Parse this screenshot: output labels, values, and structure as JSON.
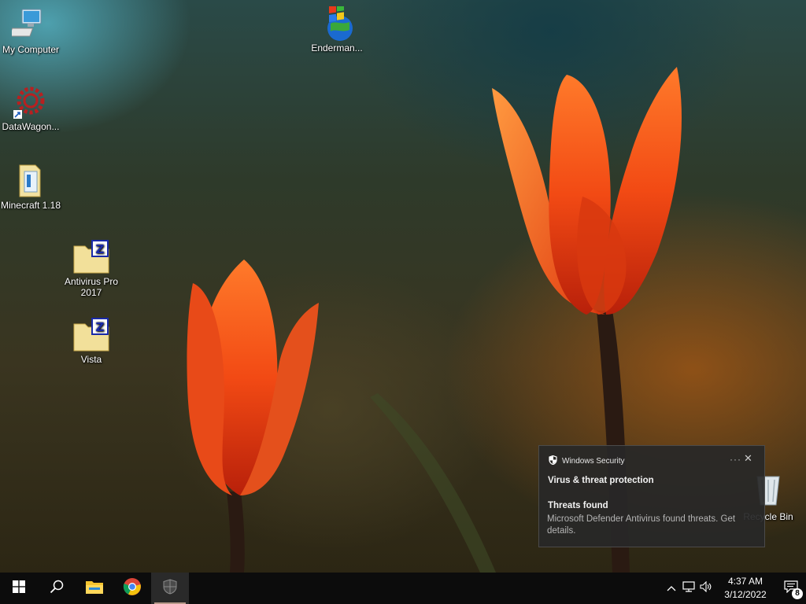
{
  "desktop": {
    "icons": [
      {
        "label": "My Computer"
      },
      {
        "label": "DataWagon..."
      },
      {
        "label": "Minecraft 1.18"
      },
      {
        "label": "Antivirus Pro 2017"
      },
      {
        "label": "Vista"
      },
      {
        "label": "Enderman..."
      }
    ],
    "recycle_bin": {
      "label": "Recycle Bin"
    }
  },
  "toast": {
    "app_name": "Windows Security",
    "more_label": "···",
    "close_label": "✕",
    "title": "Virus & threat protection",
    "subtitle": "Threats found",
    "body": "Microsoft Defender Antivirus found threats. Get details."
  },
  "taskbar": {
    "pinned": [
      {
        "name": "start-icon"
      },
      {
        "name": "search-icon"
      },
      {
        "name": "file-explorer-icon"
      },
      {
        "name": "chrome-icon"
      },
      {
        "name": "windows-security-icon",
        "active": true
      }
    ],
    "tray": {
      "time": "4:37 AM",
      "date": "3/12/2022",
      "notification_count": "8"
    }
  },
  "colors": {
    "accent": "#b89a8a",
    "taskbar": "#0c0c0c",
    "toast_bg": "#282828"
  }
}
